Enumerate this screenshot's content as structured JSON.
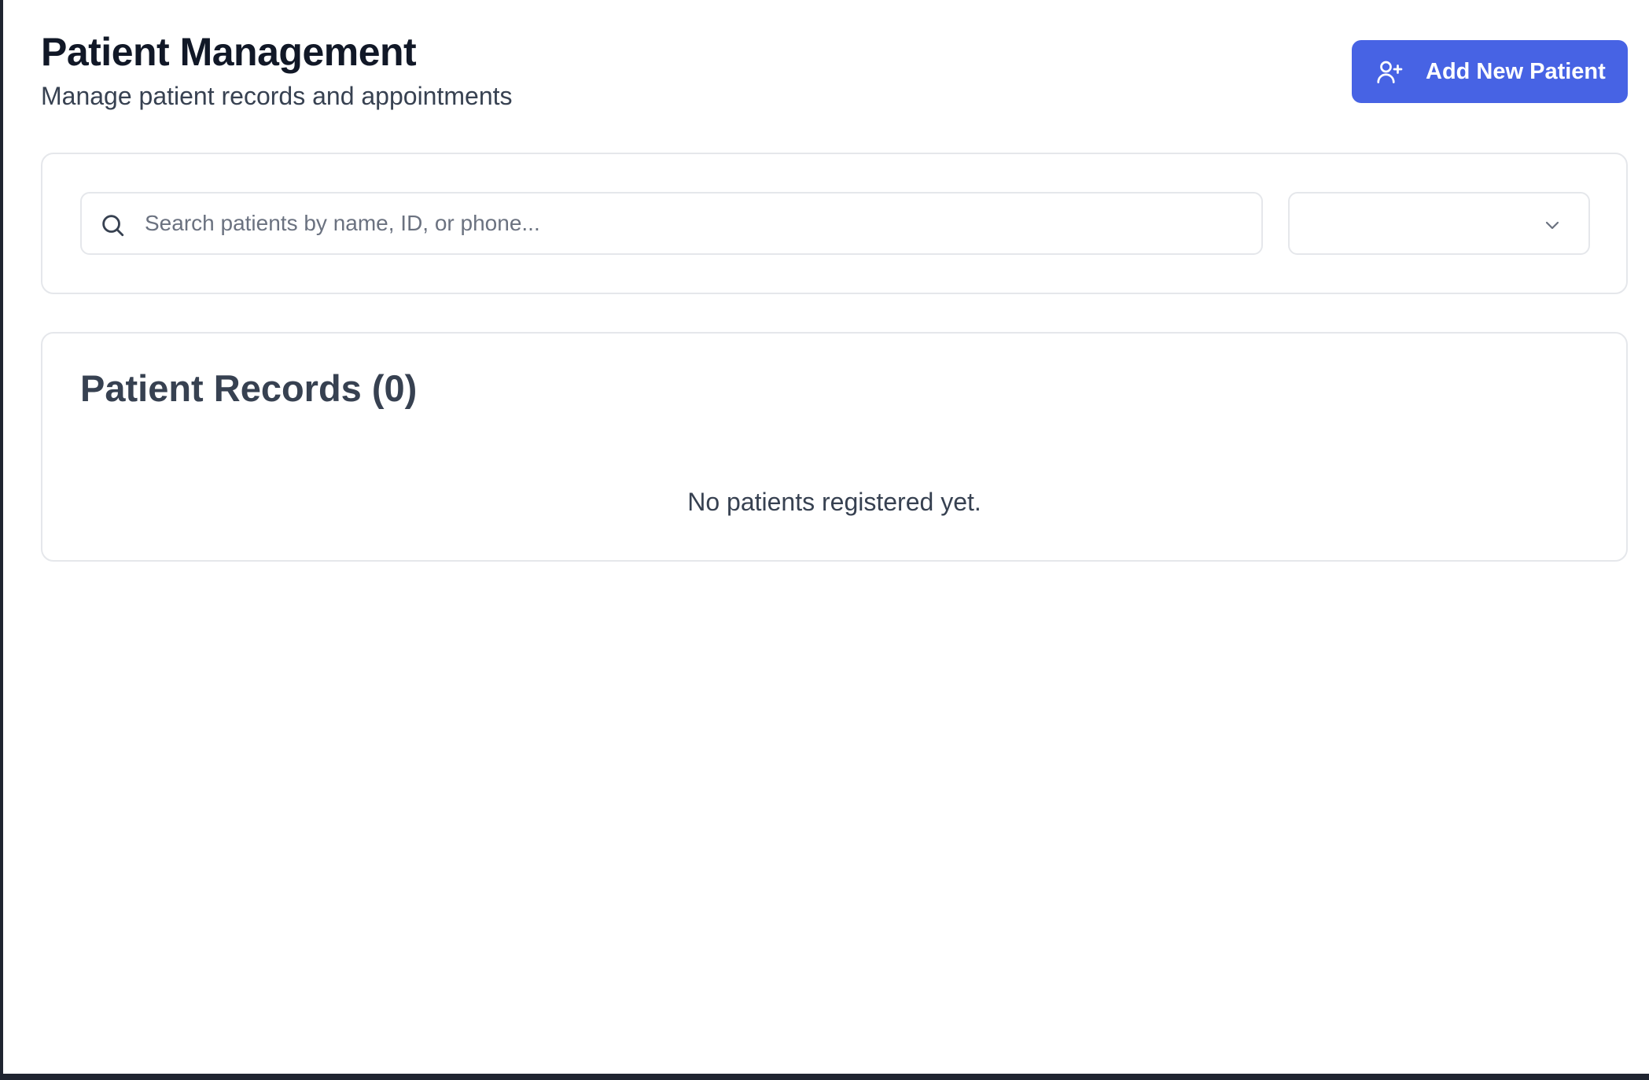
{
  "header": {
    "title": "Patient Management",
    "subtitle": "Manage patient records and appointments"
  },
  "actions": {
    "add_patient_label": "Add New Patient",
    "add_patient_icon": "user-plus-icon"
  },
  "filters": {
    "search": {
      "placeholder": "Search patients by name, ID, or phone...",
      "value": "",
      "icon": "search-icon"
    },
    "select": {
      "selected_value": "",
      "icon": "chevron-down-icon"
    }
  },
  "records": {
    "title": "Patient Records (0)",
    "empty_message": "No patients registered yet."
  },
  "colors": {
    "primary": "#4763e4",
    "border": "#e5e7eb",
    "text_dark": "#111827",
    "text_muted": "#374151",
    "placeholder": "#6b7280"
  }
}
